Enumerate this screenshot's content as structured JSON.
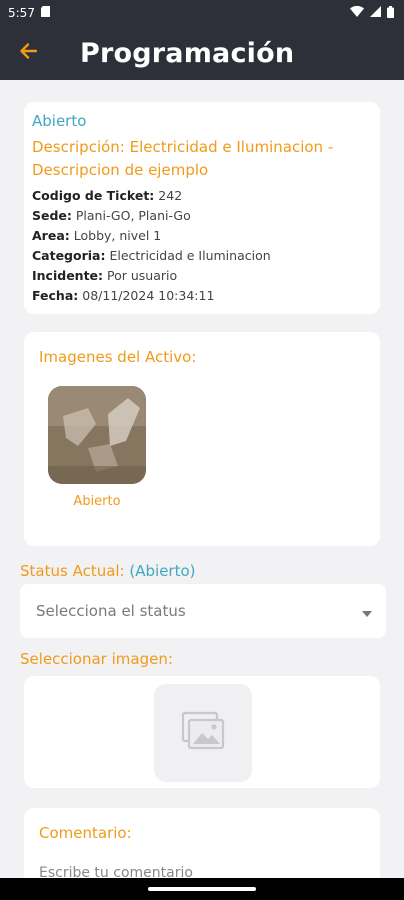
{
  "statusbar": {
    "time": "5:57"
  },
  "header": {
    "title": "Programación"
  },
  "ticket": {
    "status": "Abierto",
    "description": "Descripción: Electricidad e Iluminacion - Descripcion de ejemplo",
    "rows": [
      {
        "label": "Codigo de Ticket:",
        "value": "242"
      },
      {
        "label": "Sede:",
        "value": "Plani-GO, Plani-Go"
      },
      {
        "label": "Area:",
        "value": "Lobby, nivel 1"
      },
      {
        "label": "Categoria:",
        "value": "Electricidad e Iluminacion"
      },
      {
        "label": "Incidente:",
        "value": "Por usuario"
      },
      {
        "label": "Fecha:",
        "value": "08/11/2024 10:34:11"
      }
    ]
  },
  "assets": {
    "title": "Imagenes del Activo:",
    "image_label": "Abierto"
  },
  "status_section": {
    "label": "Status Actual:",
    "current": "(Abierto)",
    "dropdown_placeholder": "Selecciona el status"
  },
  "image_section": {
    "label": "Seleccionar imagen:"
  },
  "comment_section": {
    "title": "Comentario:",
    "placeholder": "Escribe tu comentario"
  },
  "colors": {
    "accent_orange": "#f19a1a",
    "status_blue": "#3fa7c2",
    "header_bg": "#2d3038"
  }
}
